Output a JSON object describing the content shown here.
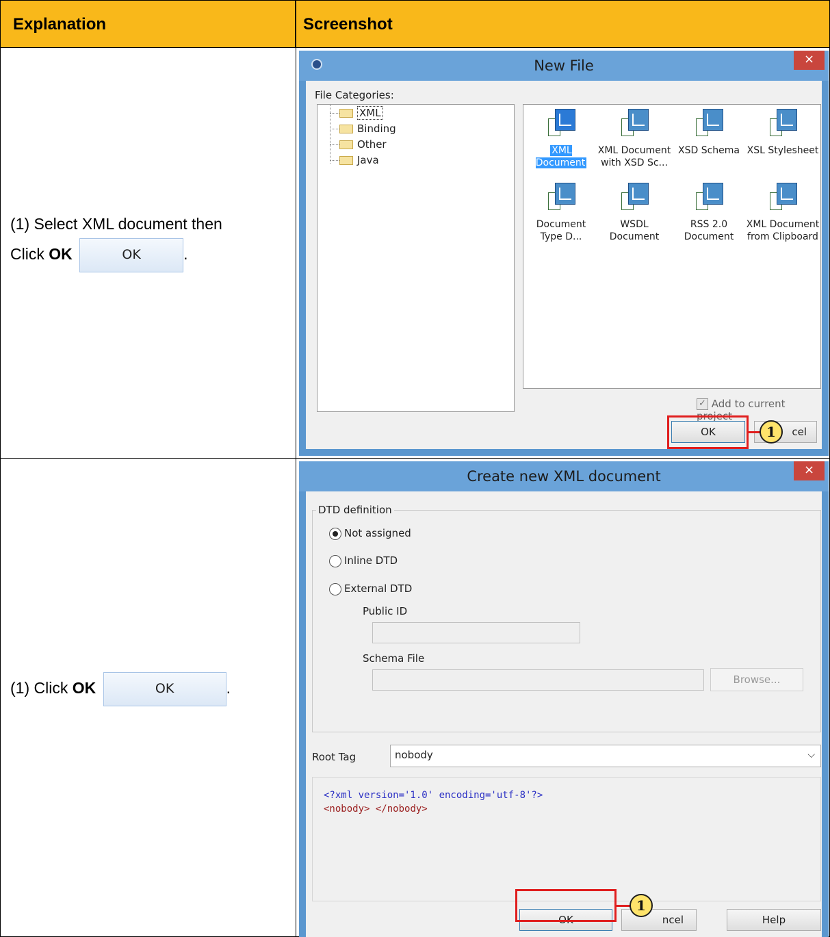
{
  "headers": {
    "explanation": "Explanation",
    "screenshot": "Screenshot"
  },
  "rows": [
    {
      "step_prefix": "(1) Select XML document then",
      "click_word": "Click ",
      "bold_ok": "OK",
      "btn_label": "OK",
      "period": "."
    },
    {
      "step_prefix": "(1) Click ",
      "bold_ok": "OK",
      "btn_label": "OK",
      "period": "."
    }
  ],
  "new_file": {
    "title": "New File",
    "close": "×",
    "categories_label": "File Categories:",
    "tree": [
      "XML",
      "Binding",
      "Other",
      "Java"
    ],
    "tiles_row1": [
      {
        "l1": "XML Document",
        "l2": ""
      },
      {
        "l1": "XML Document",
        "l2": "with XSD Sc..."
      },
      {
        "l1": "XSD Schema",
        "l2": ""
      },
      {
        "l1": "XSL Stylesheet",
        "l2": ""
      }
    ],
    "tiles_row2": [
      {
        "l1": "Document",
        "l2": "Type D..."
      },
      {
        "l1": "WSDL",
        "l2": "Document"
      },
      {
        "l1": "RSS 2.0",
        "l2": "Document"
      },
      {
        "l1": "XML Document",
        "l2": "from Clipboard"
      }
    ],
    "add_to_project": "Add to current project",
    "ok": "OK",
    "cancel_fragment": "cel",
    "callout": "1"
  },
  "create_xml": {
    "title": "Create new XML document",
    "close": "×",
    "dtd_group": "DTD definition",
    "radios": [
      "Not assigned",
      "Inline DTD",
      "External DTD"
    ],
    "public_id": "Public ID",
    "schema_file": "Schema File",
    "browse": "Browse...",
    "root_tag_label": "Root Tag",
    "root_tag_value": "nobody",
    "code_line1": "<?xml version='1.0' encoding='utf-8'?>",
    "code_line2_open": "<nobody>",
    "code_line2_close": "</nobody>",
    "ok": "OK",
    "cancel_fragment": "ncel",
    "help": "Help",
    "callout": "1"
  },
  "colors": {
    "header_bg": "#f9b81a",
    "title_bar": "#6aa3d9",
    "highlight_red": "#e01e1e",
    "callout_yellow": "#ffe46b"
  }
}
